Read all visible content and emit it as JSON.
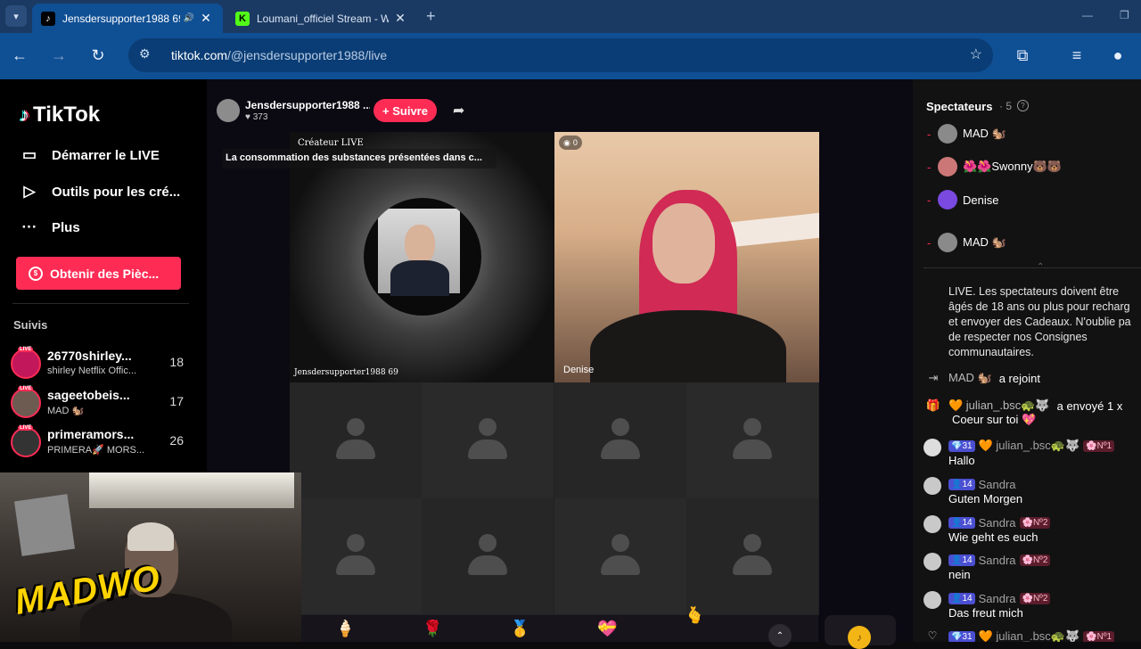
{
  "browser": {
    "tabs": [
      {
        "title": "Jensdersupporter1988 69",
        "active": true
      },
      {
        "title": "Loumani_officiel Stream - W",
        "active": false
      }
    ],
    "url_host": "tiktok.com",
    "url_path": "/@jensdersupporter1988/live",
    "colors": {
      "tabbar": "#1b3a63",
      "toolbar": "#0f4f94"
    }
  },
  "sidebar": {
    "logo_text": "TikTok",
    "nav": [
      {
        "label": "Démarrer le LIVE",
        "icon": "video-camera-icon"
      },
      {
        "label": "Outils pour les cré...",
        "icon": "play-tools-icon"
      },
      {
        "label": "Plus",
        "icon": "more-dots-icon"
      }
    ],
    "coins_button": "Obtenir des Pièc...",
    "following_title": "Suivis",
    "following": [
      {
        "name": "26770shirley...",
        "sub": "shirley Netflix Offic...",
        "count": "18",
        "live_badge": "LIVE"
      },
      {
        "name": "sageetobeis...",
        "sub": "MAD 🐿️",
        "count": "17",
        "live_badge": "LIVE"
      },
      {
        "name": "primeramors...",
        "sub": "PRIMERA🚀 MORS...",
        "count": "26",
        "live_badge": "LIVE"
      }
    ]
  },
  "webcam": {
    "brand_text": "MADWO"
  },
  "live": {
    "host_name": "Jensdersupporter1988 ...",
    "host_likes": "♥ 373",
    "follow_label": "+ Suivre",
    "creator_badge": "Créateur LIVE",
    "warning_text": "La consommation des substances présentées dans c...",
    "host_tile_label": "Jensdersupporter1988 69",
    "guest_name": "Denise",
    "guest_count": "0"
  },
  "chat": {
    "title": "Spectateurs",
    "viewer_count": "· 5",
    "viewers": [
      {
        "name": "MAD 🐿️",
        "color": "#8a8a8a"
      },
      {
        "name": "🌺🌺Swonny🐻🐻",
        "color": "#c77"
      },
      {
        "name": "Denise",
        "color": "#7a49e0"
      },
      {
        "name": "MAD 🐿️",
        "color": "#8a8a8a"
      }
    ],
    "notice": "LIVE. Les spectateurs doivent être âgés de 18 ans ou plus pour recharg et envoyer des Cadeaux. N'oublie pa de respecter nos Consignes communautaires.",
    "join_user": "MAD 🐿️",
    "join_text": "a rejoint",
    "gift_user": "🧡 julian_.bsc🐢🐺",
    "gift_text": "a envoyé 1 x",
    "gift_item": "Coeur sur toi 💖",
    "messages": [
      {
        "level": "💎31",
        "user": "🧡 julian_.bsc🐢🐺",
        "rank": "🌸Nº1",
        "text": "Hallo"
      },
      {
        "level": "👤14",
        "user": "Sandra",
        "rank": "",
        "text": "Guten Morgen"
      },
      {
        "level": "👤14",
        "user": "Sandra",
        "rank": "🌸Nº2",
        "text": "Wie geht es euch"
      },
      {
        "level": "👤14",
        "user": "Sandra",
        "rank": "🌸Nº2",
        "text": "nein"
      },
      {
        "level": "👤14",
        "user": "Sandra",
        "rank": "🌸Nº2",
        "text": "Das freut mich"
      },
      {
        "level": "💎31",
        "user": "🧡 julian_.bsc🐢🐺",
        "rank": "🌸Nº1",
        "text": ""
      }
    ]
  }
}
